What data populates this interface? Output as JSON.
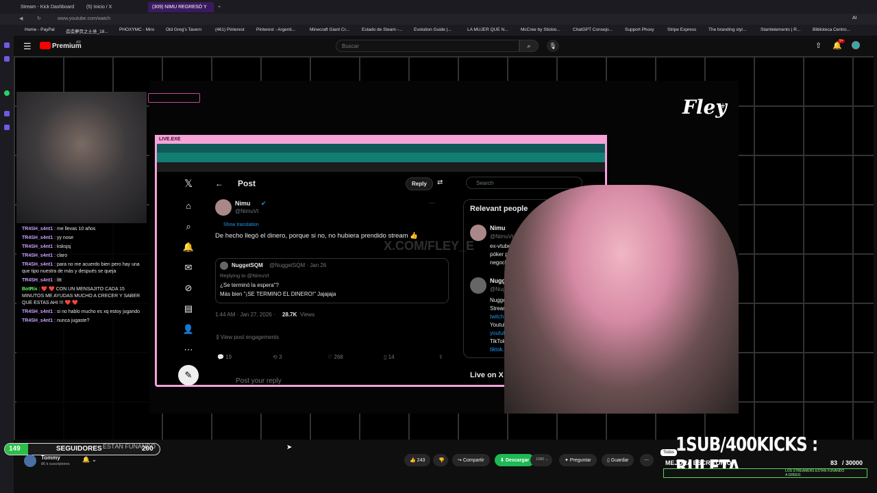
{
  "browser": {
    "tabs": [
      "Stream - Kick Dashboard",
      "(5) Inicio / X",
      "(309) NIMU REGRESÓ Y"
    ],
    "url": "www.youtube.com/watch",
    "bookmarks": [
      "Home - PayPal",
      "造造夢页之土坐_18...",
      "PHOXYMC - Miro",
      "Old Greg's Tavern",
      "(461) Pinterest",
      "Pinterest - Argenti...",
      "Minecraft Giant Cr...",
      "Estado de Steam -...",
      "Evolution Guide |...",
      "LA MUJER QUE N...",
      "McCree by Stickio...",
      "ChatGPT Consejo...",
      "Support Phoxy",
      "Stripe Express",
      "The branding styl...",
      "Stamlelements | R...",
      "Biblioteca Centro..."
    ],
    "ai_label": "AI"
  },
  "youtube": {
    "logo": "Premium",
    "logo_sup": "AR",
    "search_placeholder": "Buscar",
    "notif_badge": "9+"
  },
  "stream": {
    "chat": [
      {
        "user": "TR4SH_s4nt1",
        "text": "me llevas 10 años"
      },
      {
        "user": "TR4SH_s4nt1",
        "text": "yy nose"
      },
      {
        "user": "TR4SH_s4nt1",
        "text": "ksksjsj"
      },
      {
        "user": "TR4SH_s4nt1",
        "text": "claro"
      },
      {
        "user": "TR4SH_s4nt1",
        "text": "para no me acuerdo bien pero hay una que tipo nuestra de más y después se queja"
      },
      {
        "user": "TR4SH_s4nt1",
        "text": "litt"
      },
      {
        "user": "BotRix",
        "text": "❤️ ❤️ CON UN MENSAJITO CADA 15 MINUTOS ME AYUDAS MUCHO A CRECER Y SABER QUE ESTAS AHI !!! ❤️ ❤️"
      },
      {
        "user": "TR4SH_s4nt1",
        "text": "si no hablo mucho es xq estoy jugando"
      },
      {
        "user": "TR4SH_s4nt1",
        "text": "nunca jugaste?"
      }
    ],
    "brand": "Fley",
    "window_title": "LIVE.EXE",
    "watermark": "X.COM/FLEY_E",
    "follow_count": "149",
    "follow_label": "SEGUIDORES",
    "follow_goal": "200",
    "follow_sub": "ESTÁN FUNANDO",
    "ruleta": "1SUB/400KICKS : RULETA",
    "mejora": "MEJORA ESCRITORIO",
    "goal_current": "83",
    "goal_target": "/ 30000",
    "goal_sub": "LOS STREAMERS ESTAN FUNANDO A GREEG",
    "todos": "Todos"
  },
  "x_post": {
    "header": "Post",
    "reply_btn": "Reply",
    "search": "Search",
    "author": "Nimu",
    "handle": "@NimuVt",
    "translate": "Show translation",
    "text": "De hecho llegó el dinero,  porque si no, no hubiera prendido stream 👍",
    "quote_author": "NuggetSQM",
    "quote_meta": "@NuggetSQM · Jan 26",
    "quote_reply": "Replying to @NimuVt",
    "quote_line1": "¿Se terminó la espera\"?",
    "quote_line2": "Más bien \"¡SE TERMINO EL DINERO!\" Jajajaja",
    "time": "1:44 AM · Jan 27, 2026 ·",
    "views_num": "28.7K",
    "views_label": "Views",
    "engagements": "View post engagements",
    "stats": {
      "replies": "19",
      "reposts": "3",
      "likes": "268",
      "bookmarks": "14"
    },
    "reply_placeholder": "Post your reply",
    "relevant_title": "Relevant people",
    "rel1_name": "Nimu",
    "rel1_handle": "@NimuVt",
    "rel1_bio1": "ex-vtuber, futura jugadora de",
    "rel1_bio2": "póker profesional 🐟",
    "rel1_bio3": "negocios@nimuspacecat.com",
    "rel2_name": "NuggetSQM",
    "rel2_handle": "@NuggetSQM",
    "rel2_bio1": "Nugget Majesty //",
    "rel2_bio2": "Streamer on",
    "rel2_bio3": "twitch.tv/Nugget",
    "rel2_bio4": "Youtube:",
    "rel2_bio5": "youtube.com/@Nug",
    "rel2_bio6": "TikTok:",
    "rel2_bio7": "tiktok.com/@nugget",
    "live_title": "Live on X"
  },
  "channel": {
    "name": "Tommy",
    "subs": "86 k suscriptores"
  },
  "actions": {
    "likes": "243",
    "share": "Compartir",
    "download": "Descargar",
    "quality": "1080",
    "ask": "Preguntar",
    "save": "Guardar"
  }
}
